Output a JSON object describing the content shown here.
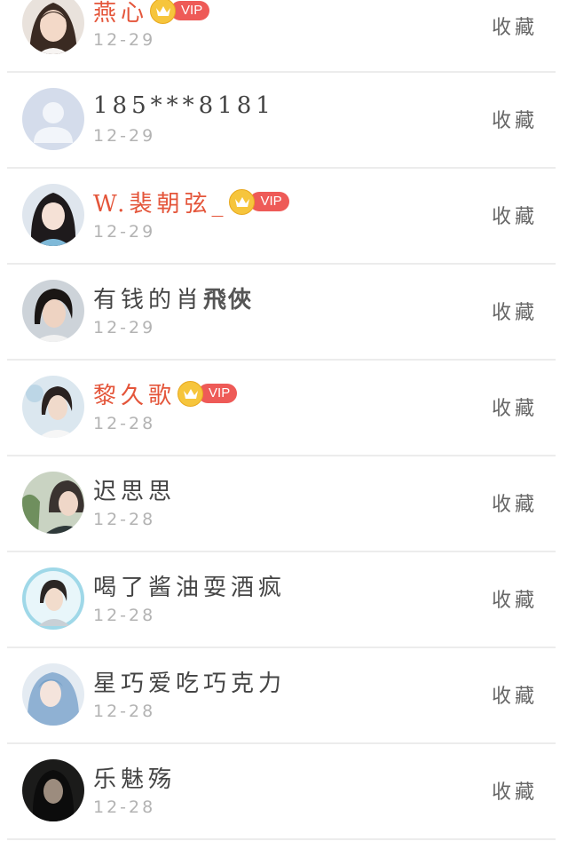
{
  "collect_label": "收藏",
  "vip_label": "VIP",
  "colors": {
    "vip_name": "#e4553a",
    "normal_name": "#444444",
    "date": "#b3b3b3",
    "vip_pill": "#ee5a57",
    "crown": "#f6c53c",
    "divider": "#ececec"
  },
  "items": [
    {
      "name": "燕心",
      "date": "12-29",
      "vip": true,
      "avatar": "girl-portrait"
    },
    {
      "name": "185***8181",
      "date": "12-29",
      "vip": false,
      "avatar": "default-silhouette"
    },
    {
      "name": "W.裴朝弦_",
      "date": "12-29",
      "vip": true,
      "avatar": "girl-portrait"
    },
    {
      "name": "有钱的肖",
      "name_tail": "飛俠",
      "date": "12-29",
      "vip": false,
      "avatar": "man-portrait"
    },
    {
      "name": "黎久歌",
      "date": "12-28",
      "vip": true,
      "avatar": "man-portrait"
    },
    {
      "name": "迟思思",
      "date": "12-28",
      "vip": false,
      "avatar": "girl-portrait"
    },
    {
      "name": "喝了酱油耍酒疯",
      "date": "12-28",
      "vip": false,
      "avatar": "boy-portrait"
    },
    {
      "name": "星巧爱吃巧克力",
      "date": "12-28",
      "vip": false,
      "avatar": "anime-portrait"
    },
    {
      "name": "乐魅殇",
      "date": "12-28",
      "vip": false,
      "avatar": "dark-portrait"
    }
  ]
}
